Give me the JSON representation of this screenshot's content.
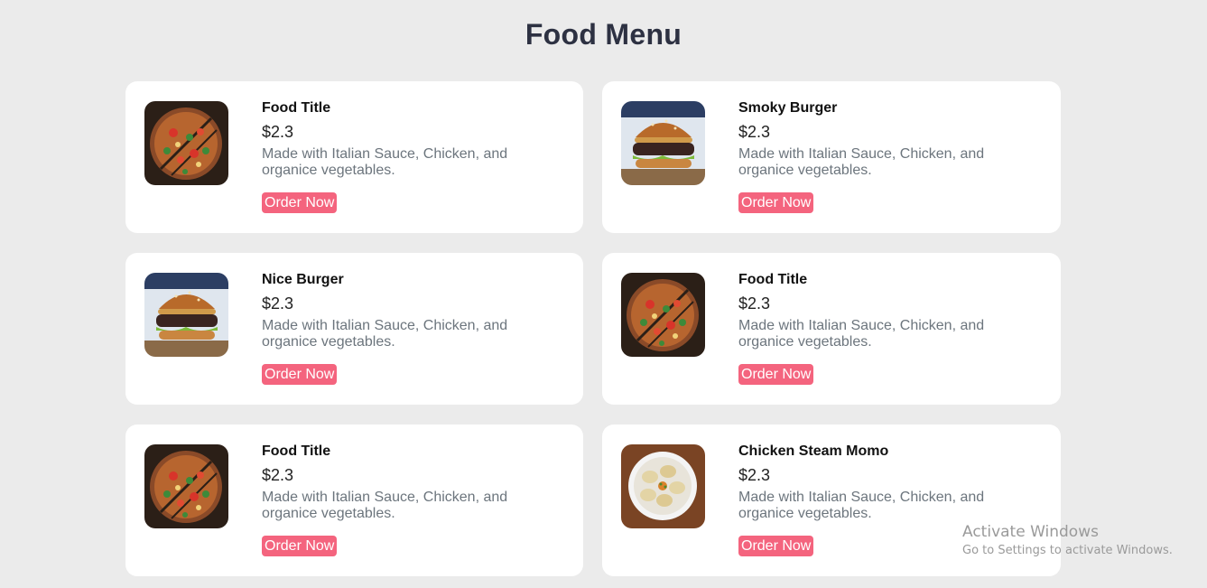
{
  "header": {
    "title": "Food Menu"
  },
  "menu": [
    {
      "title": "Food Title",
      "price": "$2.3",
      "description": "Made with Italian Sauce, Chicken, and organice vegetables.",
      "button": "Order Now",
      "image": "pizza-image"
    },
    {
      "title": "Smoky Burger",
      "price": "$2.3",
      "description": "Made with Italian Sauce, Chicken, and organice vegetables.",
      "button": "Order Now",
      "image": "burger-image"
    },
    {
      "title": "Nice Burger",
      "price": "$2.3",
      "description": "Made with Italian Sauce, Chicken, and organice vegetables.",
      "button": "Order Now",
      "image": "burger-image"
    },
    {
      "title": "Food Title",
      "price": "$2.3",
      "description": "Made with Italian Sauce, Chicken, and organice vegetables.",
      "button": "Order Now",
      "image": "pizza-image"
    },
    {
      "title": "Food Title",
      "price": "$2.3",
      "description": "Made with Italian Sauce, Chicken, and organice vegetables.",
      "button": "Order Now",
      "image": "pizza-image"
    },
    {
      "title": "Chicken Steam Momo",
      "price": "$2.3",
      "description": "Made with Italian Sauce, Chicken, and organice vegetables.",
      "button": "Order Now",
      "image": "momo-image"
    }
  ],
  "watermark": {
    "title": "Activate Windows",
    "subtitle": "Go to Settings to activate Windows."
  },
  "colors": {
    "background": "#ebebeb",
    "card": "#ffffff",
    "accent": "#f4647e",
    "title": "#2d3142",
    "muted": "#6c757d"
  }
}
